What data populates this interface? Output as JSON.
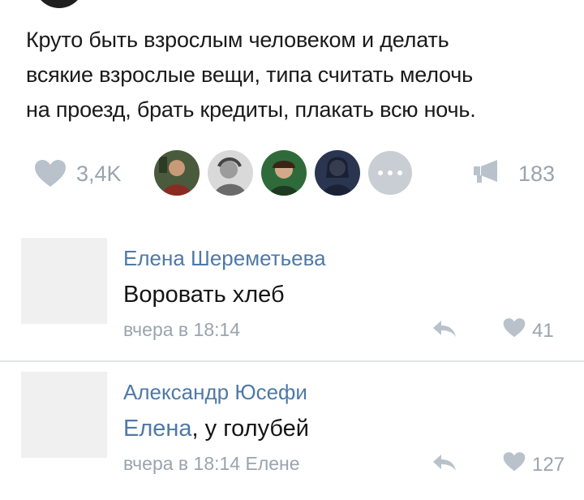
{
  "post": {
    "text_lines": [
      "Круто быть взрослым человеком и делать",
      "всякие взрослые вещи, типа считать мелочь",
      "на проезд, брать кредиты, плакать всю ночь."
    ],
    "likes_count": "3,4K",
    "reposts_count": "183",
    "icons": {
      "like": "heart-icon",
      "repost": "megaphone-icon",
      "more": "more-dots-icon"
    }
  },
  "comments": [
    {
      "author": "Елена Шереметьева",
      "text": "Воровать хлеб",
      "meta": "вчера в 18:14",
      "likes": "41"
    },
    {
      "author": "Александр Юсефи",
      "mention": "Елена",
      "text_rest": ", у голубей",
      "meta": "вчера в 18:14 Елене",
      "likes": "127"
    }
  ],
  "colors": {
    "link": "#4f79a6",
    "muted": "#9aa4ae",
    "text": "#1a1a1a",
    "avatar_placeholder": "#f0f0f0"
  }
}
